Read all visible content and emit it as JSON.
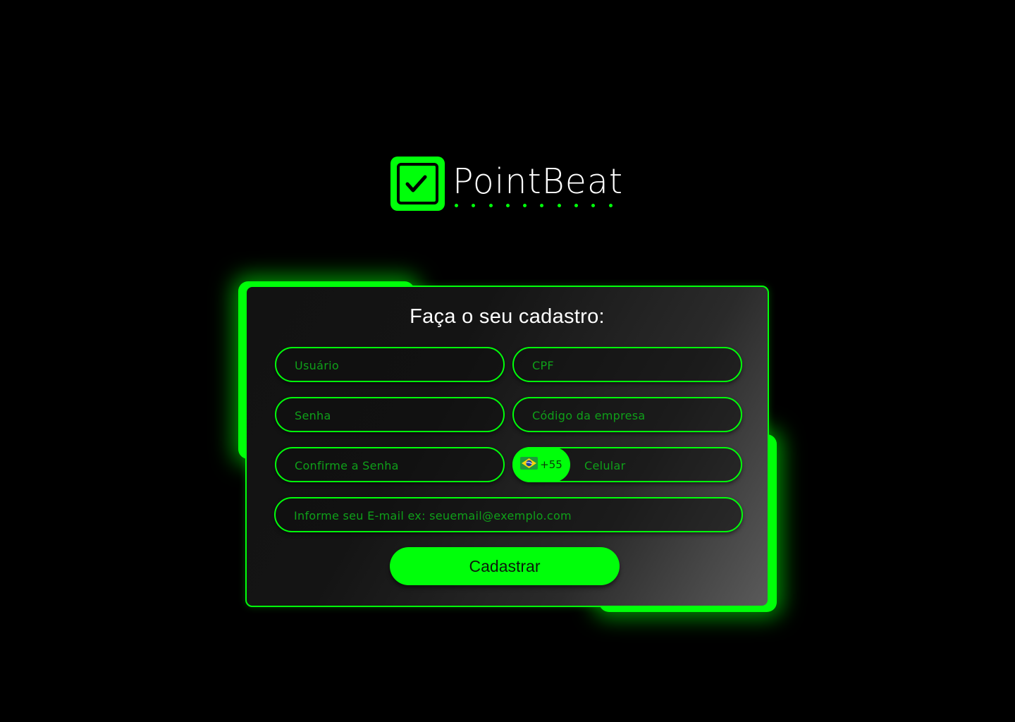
{
  "brand": {
    "name": "PointBeat",
    "logo_icon": "checkbox-check-icon",
    "accent_color": "#00ff0a"
  },
  "form": {
    "title": "Faça o seu cadastro:",
    "fields": {
      "usuario": {
        "placeholder": "Usuário",
        "value": ""
      },
      "cpf": {
        "placeholder": "CPF",
        "value": ""
      },
      "senha": {
        "placeholder": "Senha",
        "value": ""
      },
      "empresa": {
        "placeholder": "Código da empresa",
        "value": ""
      },
      "confirma_senha": {
        "placeholder": "Confirme a Senha",
        "value": ""
      },
      "celular": {
        "placeholder": "Celular",
        "value": "",
        "country_code": "+55",
        "country_flag_icon": "brazil-flag-icon"
      },
      "email": {
        "placeholder": "Informe seu E-mail ex: seuemail@exemplo.com",
        "value": ""
      }
    },
    "submit_label": "Cadastrar"
  }
}
